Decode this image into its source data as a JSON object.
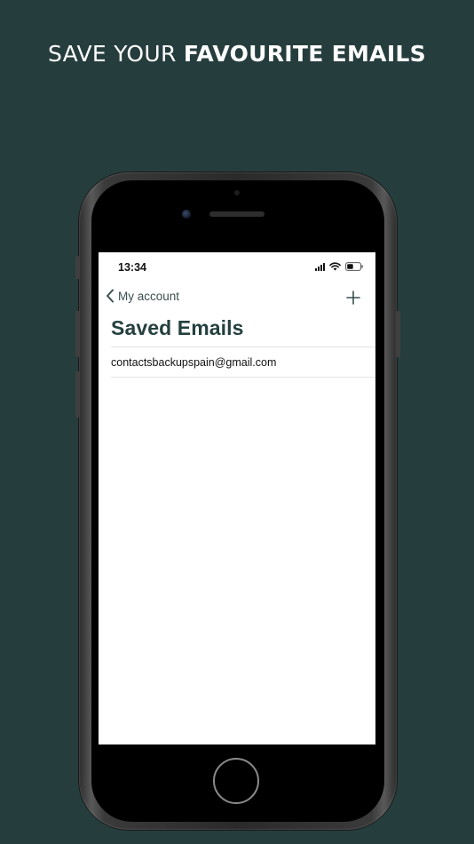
{
  "headline": {
    "light": "SAVE YOUR ",
    "bold": "FAVOURITE EMAILS"
  },
  "status_bar": {
    "time": "13:34",
    "icons": [
      "signal-icon",
      "wifi-icon",
      "battery-icon"
    ]
  },
  "nav": {
    "back_label": "My account",
    "back_icon": "chevron-left-icon",
    "add_icon": "plus-icon"
  },
  "page": {
    "title": "Saved Emails"
  },
  "emails": [
    "contactsbackupspain@gmail.com"
  ],
  "colors": {
    "background": "#263d3d",
    "accent": "#24403f",
    "nav_text": "#3a4f4f"
  }
}
